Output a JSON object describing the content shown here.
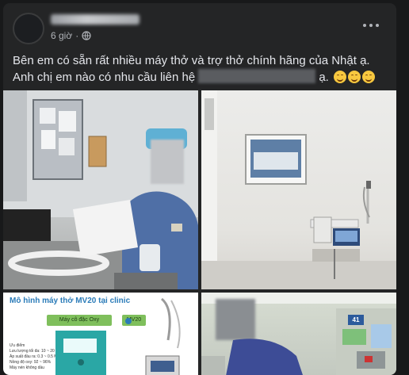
{
  "post": {
    "time": "6 giờ",
    "separator": "·",
    "text_line1": "Bên em có sẵn rất nhiều máy thở và trợ thở chính hãng của Nhật ạ.",
    "text_line2_prefix": "Anh chị em nào có nhu cầu liên hệ",
    "text_line2_suffix": "ạ."
  },
  "icons": {
    "privacy": "globe-icon",
    "menu": "more-options-icon",
    "emoji": "smiling-face-icon"
  },
  "photos": {
    "slide": {
      "title": "Mô hình máy thở MV20 tại clinic",
      "label_oxygen": "Máy cô đặc Oxy",
      "label_mv20": "MV20",
      "list_heading": "Ưu điểm",
      "list_items": [
        "Lưu lượng tối đa: 10 ~ 20 LPM",
        "Áp suất đầu ra: 0.3 ~ 0.5 Mpa",
        "Nồng độ oxy: 92 ~ 96%",
        "Máy nén không dầu"
      ]
    },
    "room_number": "41"
  },
  "colors": {
    "card_bg": "#242526",
    "page_bg": "#18191a",
    "primary_text": "#e4e6eb",
    "secondary_text": "#b0b3b8"
  }
}
